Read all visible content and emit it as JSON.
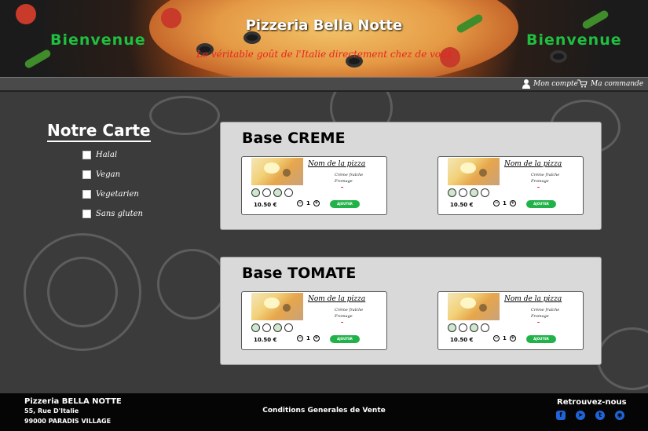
{
  "header": {
    "welcome_left": "Bienvenue",
    "welcome_right": "Bienvenue",
    "brand": "Pizzeria Bella Notte",
    "slogan": "Le véritable goût de l'Italie directement chez de vous"
  },
  "topbar": {
    "account_label": "Mon compte",
    "account_icon": "user-icon",
    "cart_label": "Ma commande",
    "cart_icon": "cart-icon"
  },
  "sidebar": {
    "title": "Notre Carte",
    "filters": [
      {
        "label": "Halal",
        "checked": false
      },
      {
        "label": "Vegan",
        "checked": false
      },
      {
        "label": "Vegetarien",
        "checked": false
      },
      {
        "label": "Sans gluten",
        "checked": false
      }
    ]
  },
  "sections": [
    {
      "title": "Base CREME",
      "cards": [
        {
          "name": "Nom de la pizza",
          "ingredients": [
            "Crème fraîche",
            "Fromage"
          ],
          "price": "10.50 €",
          "qty": "1",
          "add_label": "AJOUTER"
        },
        {
          "name": "Nom de la pizza",
          "ingredients": [
            "Crème fraîche",
            "Fromage"
          ],
          "price": "10.50 €",
          "qty": "1",
          "add_label": "AJOUTER"
        }
      ]
    },
    {
      "title": "Base TOMATE",
      "cards": [
        {
          "name": "Nom de la pizza",
          "ingredients": [
            "Crème fraîche",
            "Fromage"
          ],
          "price": "10.50 €",
          "qty": "1",
          "add_label": "AJOUTER"
        },
        {
          "name": "Nom de la pizza",
          "ingredients": [
            "Crème fraîche",
            "Fromage"
          ],
          "price": "10.50 €",
          "qty": "1",
          "add_label": "AJOUTER"
        }
      ]
    }
  ],
  "badge_icons": [
    "halal-icon",
    "vegan-icon",
    "vegetarian-icon",
    "gluten-free-icon"
  ],
  "footer": {
    "name": "Pizzeria BELLA NOTTE",
    "address_line1": "55, Rue D'Italie",
    "address_line2": "99000 PARADIS VILLAGE",
    "cgv": "Conditions Generales de Vente",
    "social_title": "Retrouvez-nous",
    "social_icons": [
      "facebook-icon",
      "telegram-icon",
      "twitter-icon",
      "discord-icon"
    ]
  },
  "colors": {
    "welcome_green": "#1fbf3f",
    "slogan_red": "#e8261c",
    "add_button_green": "#21b24a",
    "social_blue": "#1f64d8"
  }
}
